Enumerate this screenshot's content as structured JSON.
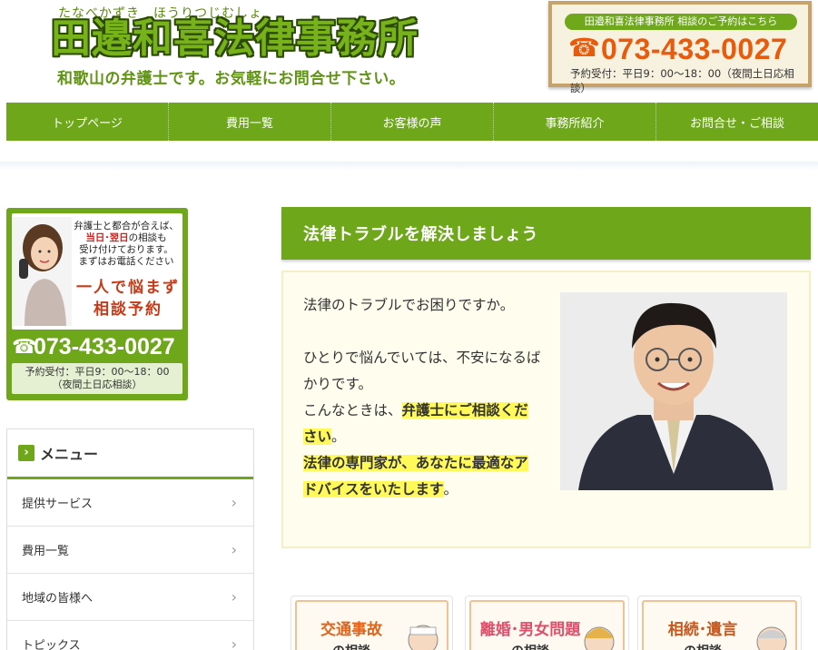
{
  "header": {
    "ruby": "たなべかずき　ほうりつじむしょ",
    "title": "田邉和喜法律事務所",
    "subtitle": "和歌山の弁護士です。お気軽にお問合せ下さい。",
    "contact": {
      "pill": "田邉和喜法律事務所 相談のご予約はこちら",
      "phone": "073-433-0027",
      "hours": "予約受付：平日9：00〜18：00（夜間土日応相談）"
    }
  },
  "nav": {
    "items": [
      {
        "label": "トップページ"
      },
      {
        "label": "費用一覧"
      },
      {
        "label": "お客様の声"
      },
      {
        "label": "事務所紹介"
      },
      {
        "label": "お問合せ・ご相談"
      }
    ]
  },
  "sidebar": {
    "banner": {
      "line1": "弁護士と都合が合えば、",
      "line2_red": "当日･翌日",
      "line2_rest": "の相談も",
      "line3": "受け付けております。",
      "line4": "まずはお電話ください",
      "big1": "一人で悩まず",
      "big2": "相談予約",
      "phone": "073-433-0027",
      "hours1": "予約受付：平日9：00〜18：00",
      "hours2": "（夜間土日応相談）"
    },
    "menu": {
      "heading": "メニュー",
      "items": [
        {
          "label": "提供サービス"
        },
        {
          "label": "費用一覧"
        },
        {
          "label": "地域の皆様へ"
        },
        {
          "label": "トピックス"
        }
      ]
    }
  },
  "main": {
    "title": "法律トラブルを解決しましょう",
    "intro": {
      "p1": "法律のトラブルでお困りですか。",
      "p2": "ひとりで悩んでいては、不安になるばかりです。",
      "p3_pre": "こんなときは、",
      "p3_hl": "弁護士にご相談ください",
      "p3_post": "。",
      "p4_hl": "法律の専門家が、あなたに最適なアドバイスをいたします",
      "p4_post": "。"
    },
    "services": [
      {
        "title": "交通事故",
        "sub": "の相談"
      },
      {
        "title": "離婚･男女問題",
        "sub": "の相談"
      },
      {
        "title": "相続･遺言",
        "sub": "の相談"
      }
    ]
  },
  "colors": {
    "brand_green": "#6ea81a",
    "phone_orange": "#e85a0c",
    "highlight": "#fffa5a"
  }
}
